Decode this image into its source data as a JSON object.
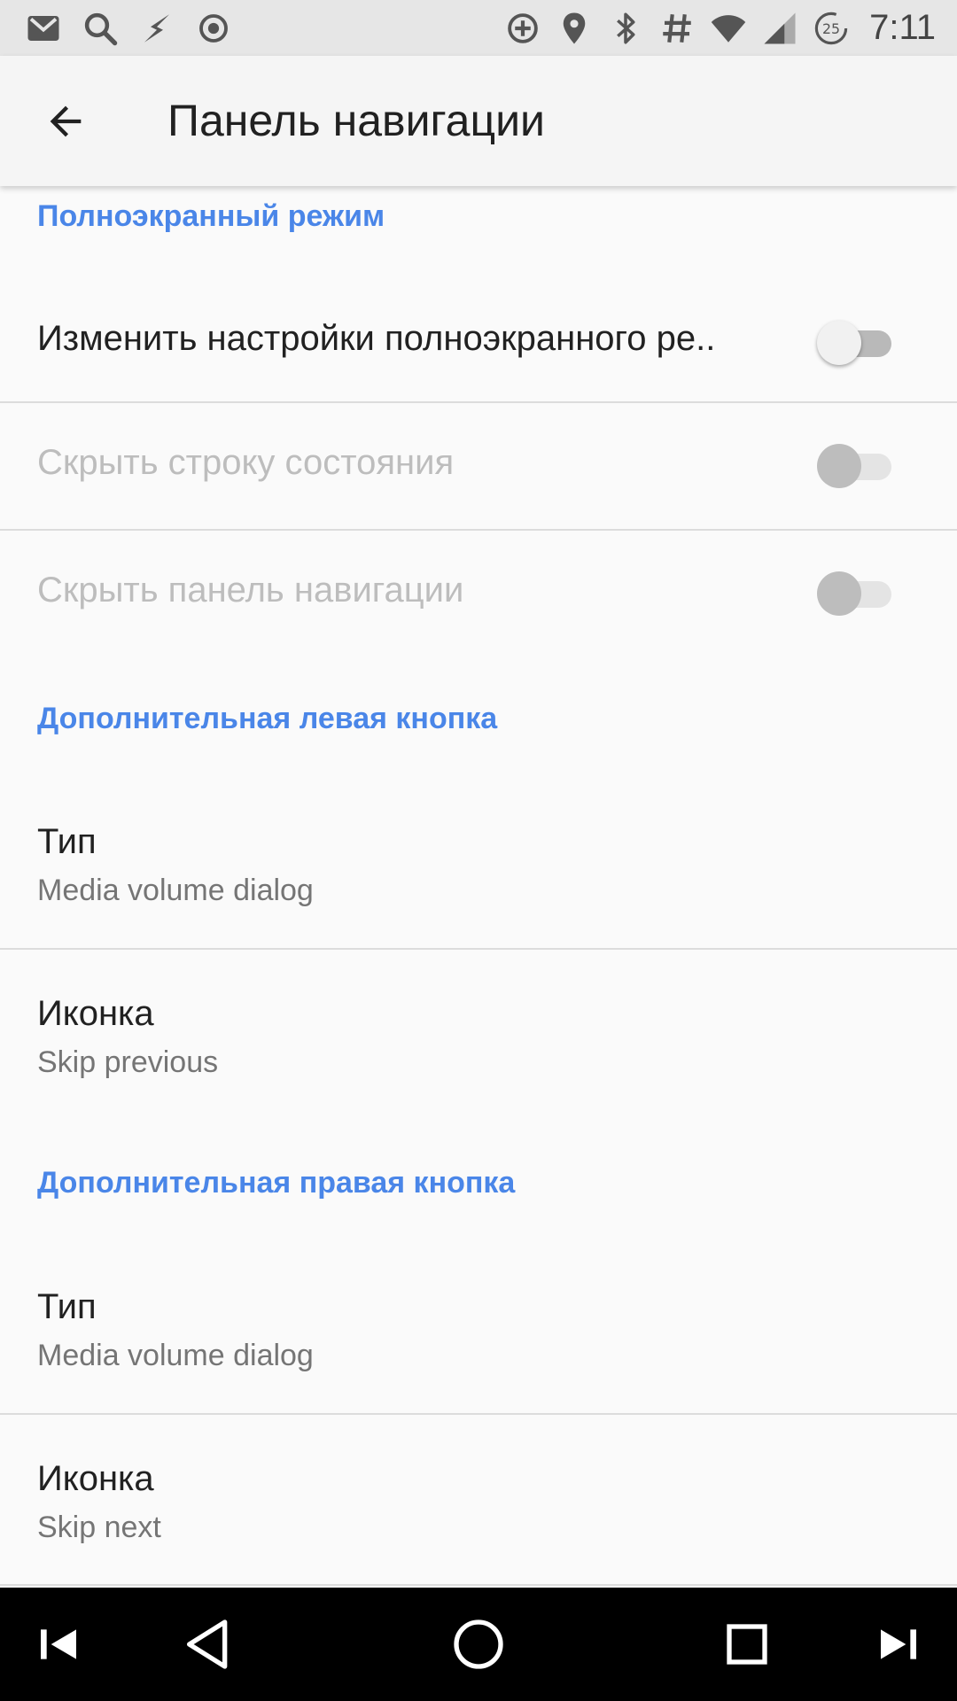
{
  "status_bar": {
    "time": "7:11",
    "left_icons": [
      "gmail-icon",
      "search-icon",
      "flash-icon",
      "target-icon"
    ],
    "right_icons": [
      "data-saver-icon",
      "location-icon",
      "bluetooth-icon",
      "hash-icon",
      "wifi-icon",
      "signal-icon",
      "battery-saver-icon"
    ],
    "badge": "25"
  },
  "app_bar": {
    "title": "Панель навигации",
    "back_icon": "arrow-back-icon"
  },
  "sections": [
    {
      "header": "Полноэкранный режим",
      "items": [
        {
          "title": "Изменить настройки полноэкранного ре..",
          "switch": "off",
          "enabled": true
        },
        {
          "title": "Скрыть строку состояния",
          "switch": "off",
          "enabled": false
        },
        {
          "title": "Скрыть панель навигации",
          "switch": "off",
          "enabled": false
        }
      ]
    },
    {
      "header": "Дополнительная левая кнопка",
      "items": [
        {
          "title": "Тип",
          "subtitle": "Media volume dialog"
        },
        {
          "title": "Иконка",
          "subtitle": "Skip previous"
        }
      ]
    },
    {
      "header": "Дополнительная правая кнопка",
      "items": [
        {
          "title": "Тип",
          "subtitle": "Media volume dialog"
        },
        {
          "title": "Иконка",
          "subtitle": "Skip next"
        }
      ]
    }
  ],
  "nav_bar": {
    "buttons": [
      "skip-previous-icon",
      "back-triangle-icon",
      "home-circle-icon",
      "recents-square-icon",
      "skip-next-icon"
    ]
  },
  "colors": {
    "accent": "#4a86e8",
    "status_bar": "#e6e6e6",
    "app_bar": "#f5f5f5",
    "background": "#fafafa",
    "nav_bar": "#000000"
  }
}
